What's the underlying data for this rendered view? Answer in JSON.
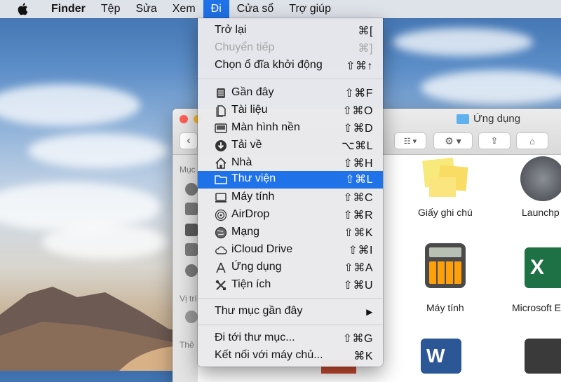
{
  "menubar": {
    "app_name": "Finder",
    "items": [
      "Tệp",
      "Sửa",
      "Xem",
      "Đi",
      "Cửa sổ",
      "Trợ giúp"
    ],
    "active_item": "Đi"
  },
  "finder_window": {
    "title": "Ứng dụng",
    "sidebar_labels": [
      "Mục",
      "Vị trí",
      "Thẻ"
    ],
    "apps": [
      {
        "label": "Giấy ghi chú"
      },
      {
        "label": "Launchp"
      },
      {
        "label": "Máy tính"
      },
      {
        "label": "Microsoft E"
      }
    ]
  },
  "go_menu": {
    "group1": [
      {
        "label": "Trở lại",
        "shortcut": "⌘[",
        "enabled": true
      },
      {
        "label": "Chuyển tiếp",
        "shortcut": "⌘]",
        "enabled": false
      },
      {
        "label": "Chọn ổ đĩa khởi động",
        "shortcut": "⇧⌘↑",
        "enabled": true
      }
    ],
    "group2": [
      {
        "label": "Gần đây",
        "shortcut": "⇧⌘F",
        "icon": "recents-icon"
      },
      {
        "label": "Tài liệu",
        "shortcut": "⇧⌘O",
        "icon": "documents-icon"
      },
      {
        "label": "Màn hình nền",
        "shortcut": "⇧⌘D",
        "icon": "desktop-icon"
      },
      {
        "label": "Tải về",
        "shortcut": "⌥⌘L",
        "icon": "downloads-icon"
      },
      {
        "label": "Nhà",
        "shortcut": "⇧⌘H",
        "icon": "home-icon"
      },
      {
        "label": "Thư viện",
        "shortcut": "⇧⌘L",
        "icon": "library-folder-icon",
        "highlighted": true
      },
      {
        "label": "Máy tính",
        "shortcut": "⇧⌘C",
        "icon": "computer-icon"
      },
      {
        "label": "AirDrop",
        "shortcut": "⇧⌘R",
        "icon": "airdrop-icon"
      },
      {
        "label": "Mạng",
        "shortcut": "⇧⌘K",
        "icon": "network-icon"
      },
      {
        "label": "iCloud Drive",
        "shortcut": "⇧⌘I",
        "icon": "icloud-icon"
      },
      {
        "label": "Ứng dụng",
        "shortcut": "⇧⌘A",
        "icon": "applications-icon"
      },
      {
        "label": "Tiện ích",
        "shortcut": "⇧⌘U",
        "icon": "utilities-icon"
      }
    ],
    "group3": [
      {
        "label": "Thư mục gần đây",
        "shortcut": "▶"
      }
    ],
    "group4": [
      {
        "label": "Đi tới thư mục...",
        "shortcut": "⇧⌘G"
      },
      {
        "label": "Kết nối với máy chủ...",
        "shortcut": "⌘K"
      }
    ]
  }
}
